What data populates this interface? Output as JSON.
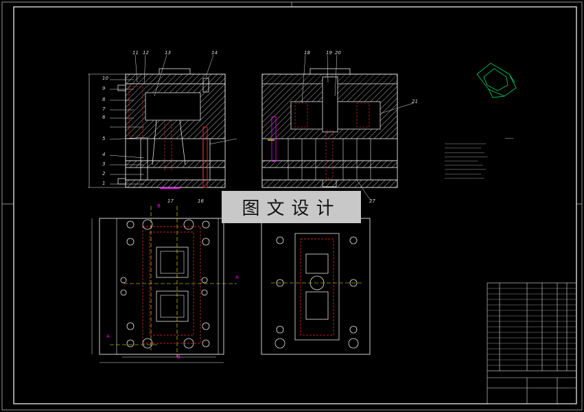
{
  "watermark": "图文设计",
  "part_numbers_top": [
    "11",
    "12",
    "13",
    "14",
    "18",
    "19",
    "20"
  ],
  "part_numbers_right": [
    "21"
  ],
  "part_numbers_left": [
    "10",
    "9",
    "8",
    "7",
    "6",
    "5",
    "4",
    "3",
    "2",
    "1"
  ],
  "part_numbers_bottom": [
    "17",
    "16",
    "27"
  ],
  "section_marks": [
    "B",
    "A",
    "B",
    "A"
  ],
  "colors": {
    "background": "#000000",
    "frame": "#ffffff",
    "body_lines": "#e8e8e8",
    "hatch": "#bfbfbf",
    "hidden": "#ff3030",
    "cut_line": "#ffff00",
    "magenta": "#ff00ff",
    "part_green": "#00c060",
    "watermark_bg": "#c8c8c8"
  }
}
